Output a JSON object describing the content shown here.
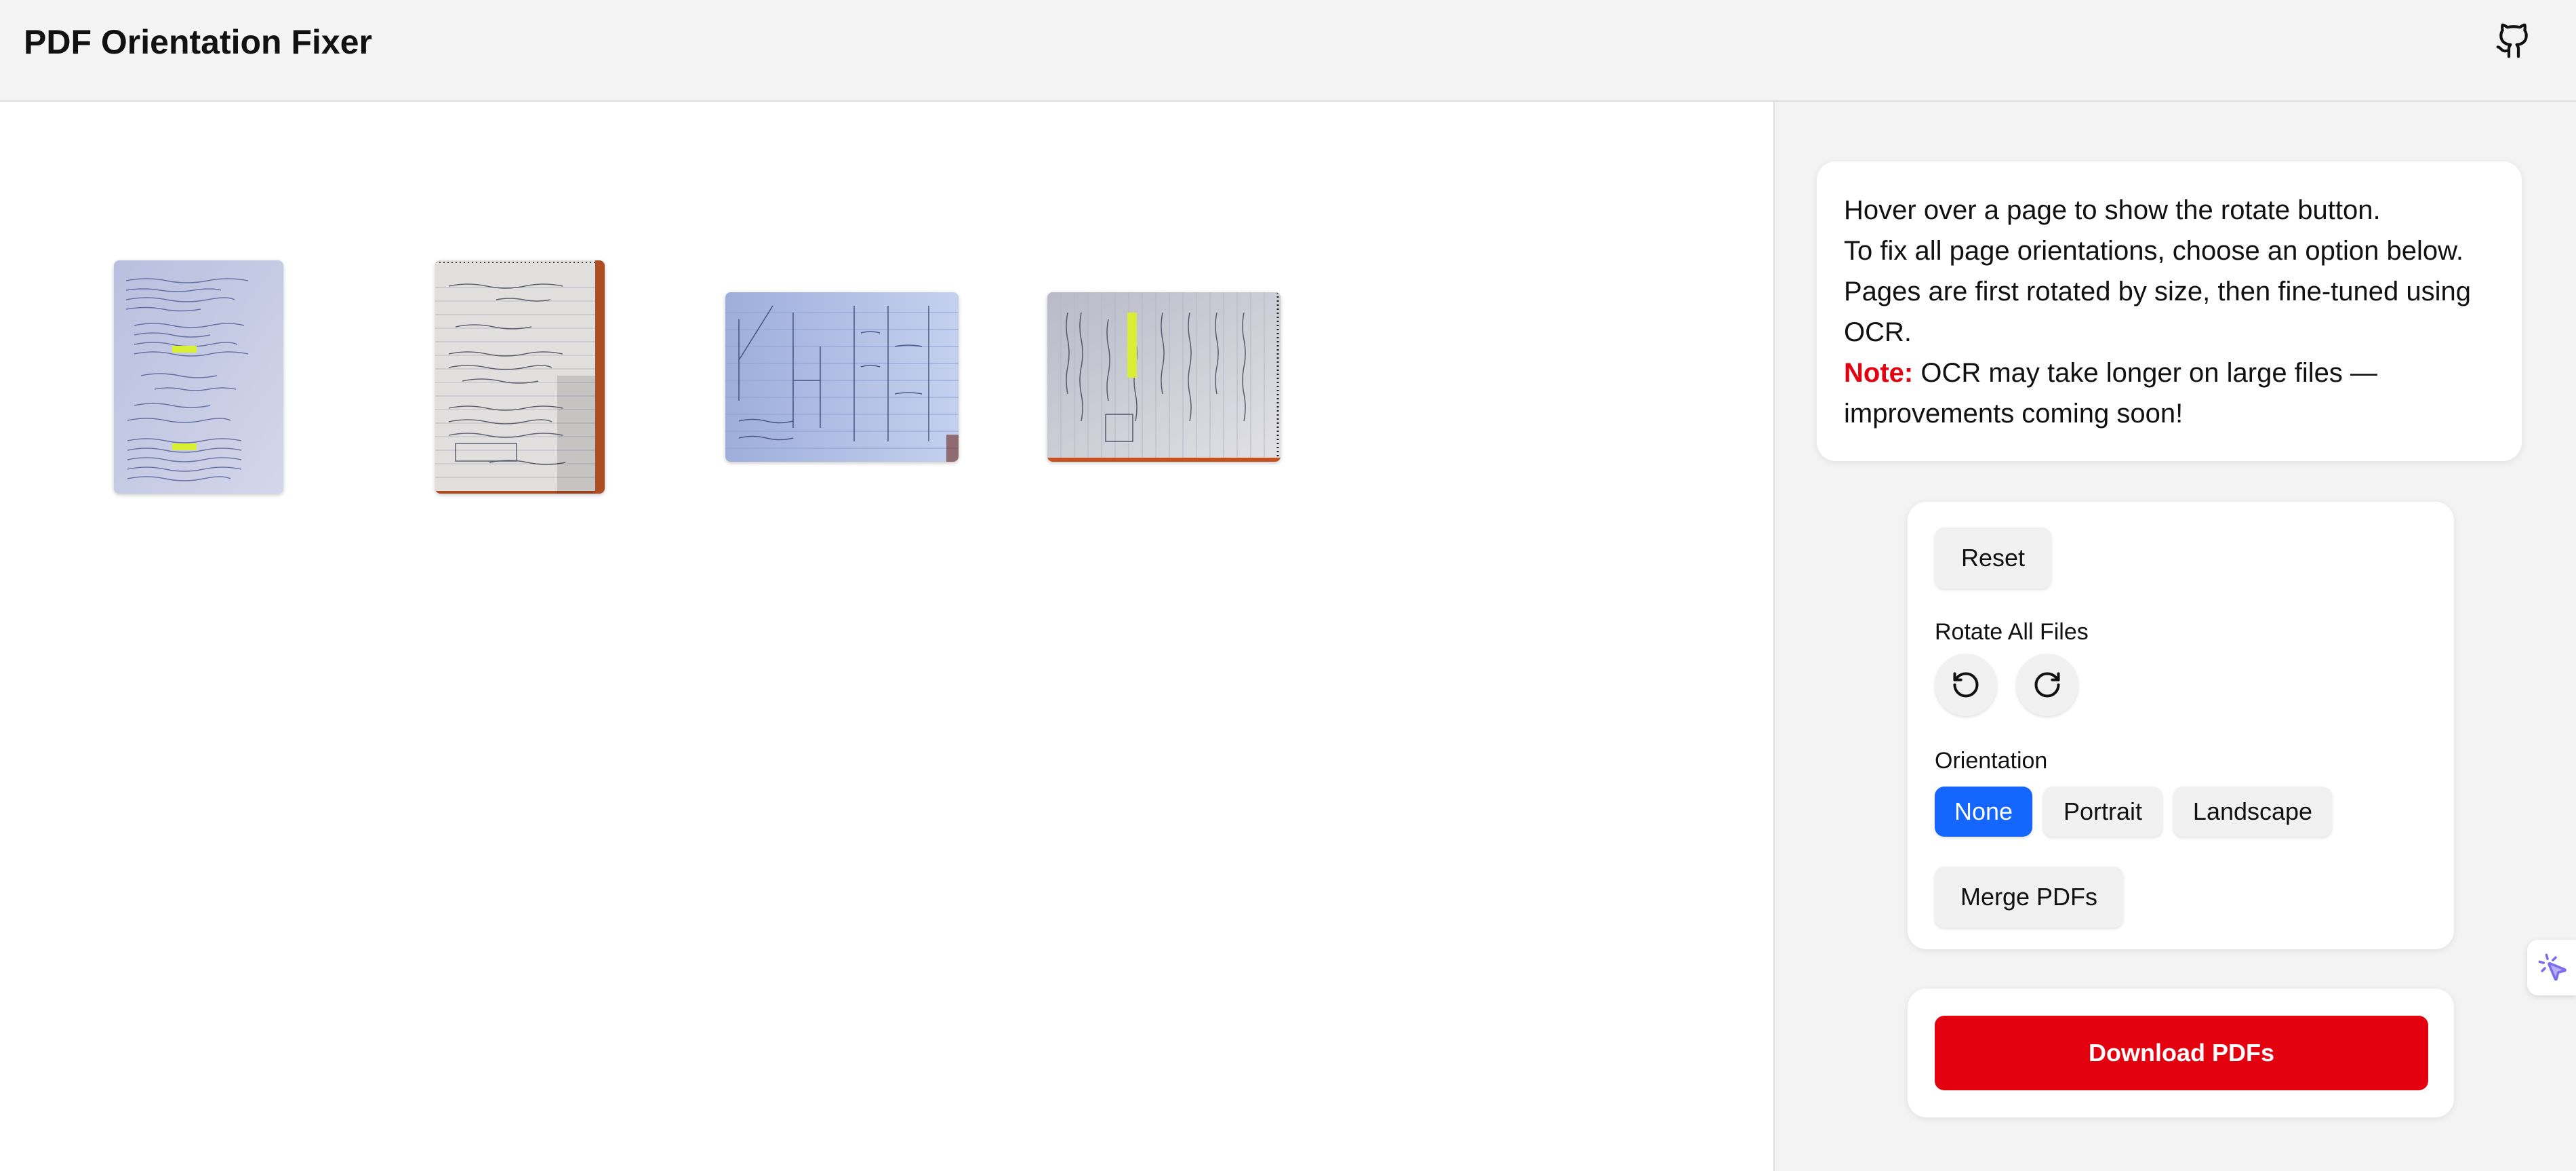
{
  "app": {
    "title": "PDF Orientation Fixer",
    "github_icon": "github-icon"
  },
  "pages": [
    {
      "name": "page-1",
      "orientation": "portrait",
      "paper_color": "#c7cde6"
    },
    {
      "name": "page-2",
      "orientation": "portrait",
      "paper_color": "#dcdcdc"
    },
    {
      "name": "page-3",
      "orientation": "landscape",
      "paper_color": "#b7c7ea"
    },
    {
      "name": "page-4",
      "orientation": "landscape",
      "paper_color": "#d2d3de"
    }
  ],
  "info": {
    "line1": "Hover over a page to show the rotate button.",
    "line2": "To fix all page orientations, choose an option below.",
    "line3": "Pages are first rotated by size, then fine-tuned using OCR.",
    "note_label": "Note:",
    "note_text": " OCR may take longer on large files — improvements coming soon!"
  },
  "controls": {
    "reset_label": "Reset",
    "rotate_all_label": "Rotate All Files",
    "rotate_left_icon": "rotate-counterclockwise-icon",
    "rotate_right_icon": "rotate-clockwise-icon",
    "orientation_label": "Orientation",
    "orientation_options": [
      "None",
      "Portrait",
      "Landscape"
    ],
    "orientation_selected": "None",
    "merge_label": "Merge PDFs"
  },
  "download": {
    "label": "Download PDFs"
  },
  "colors": {
    "accent": "#1565ff",
    "danger": "#e3000f",
    "note": "#e3000f"
  }
}
